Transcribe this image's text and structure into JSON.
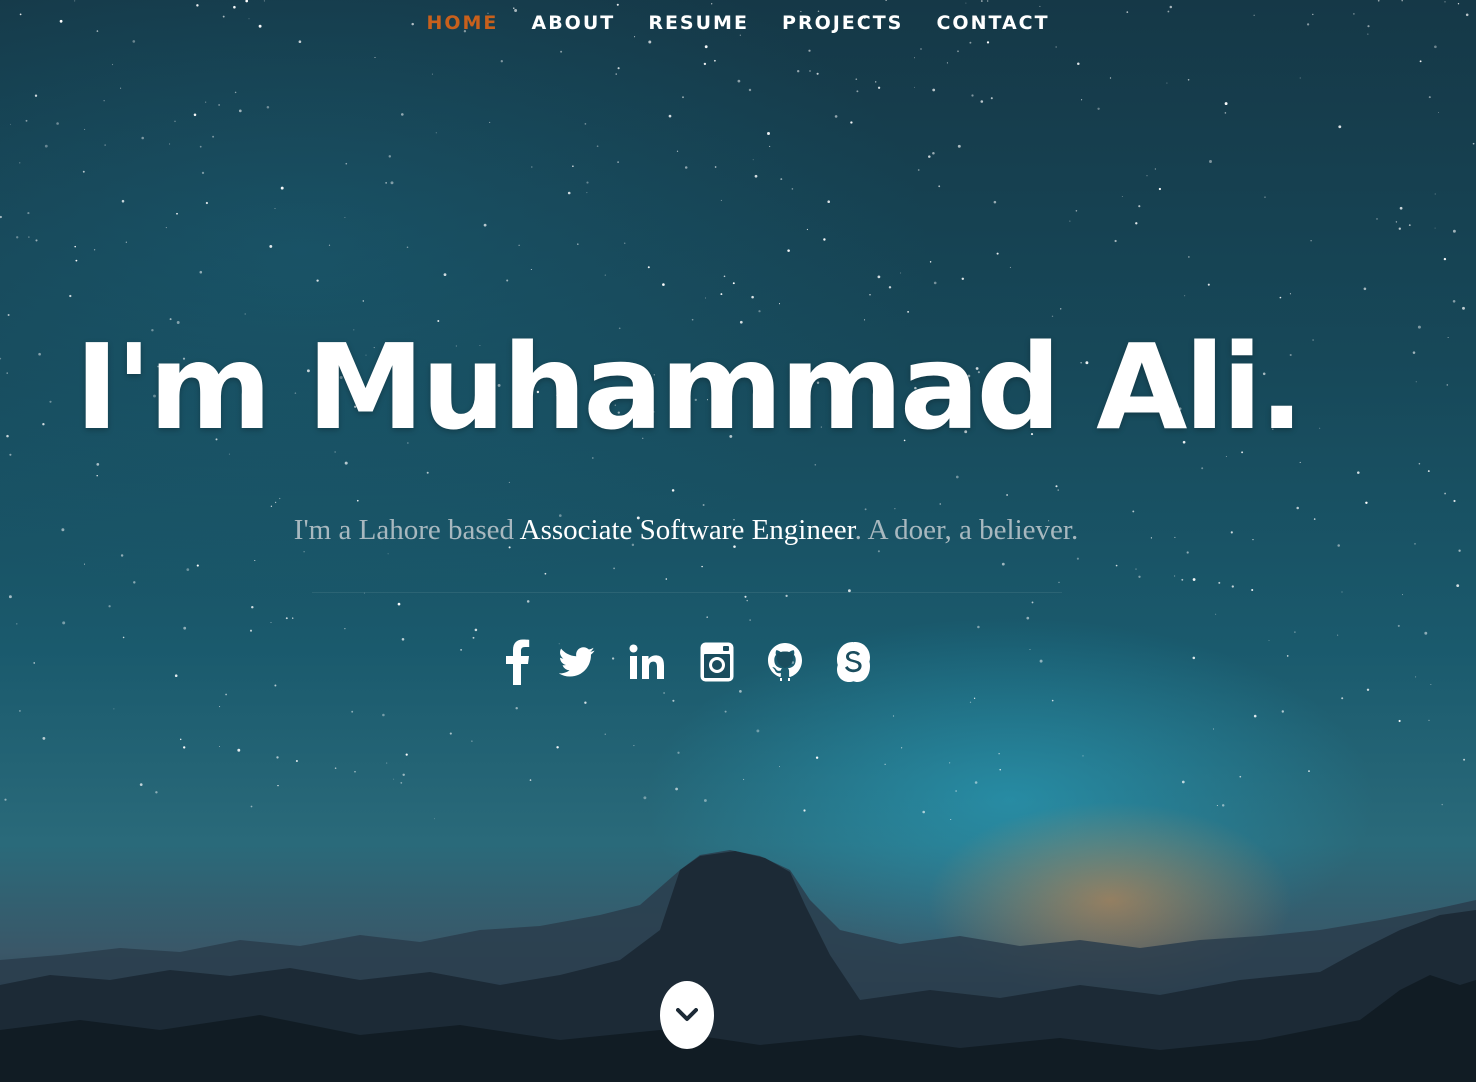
{
  "nav": {
    "items": [
      {
        "label": "HOME",
        "active": true
      },
      {
        "label": "ABOUT",
        "active": false
      },
      {
        "label": "RESUME",
        "active": false
      },
      {
        "label": "PROJECTS",
        "active": false
      },
      {
        "label": "CONTACT",
        "active": false
      }
    ],
    "active_color": "#c8601c"
  },
  "hero": {
    "headline": "I'm Muhammad Ali.",
    "tagline_prefix": "I'm a Lahore based ",
    "tagline_strong": "Associate Software Engineer",
    "tagline_suffix": ". A doer, a believer."
  },
  "social": [
    {
      "icon": "facebook-icon"
    },
    {
      "icon": "twitter-icon"
    },
    {
      "icon": "linkedin-icon"
    },
    {
      "icon": "instagram-icon"
    },
    {
      "icon": "github-icon"
    },
    {
      "icon": "skype-icon"
    }
  ],
  "scroll_down": {
    "icon": "chevron-down-icon"
  }
}
